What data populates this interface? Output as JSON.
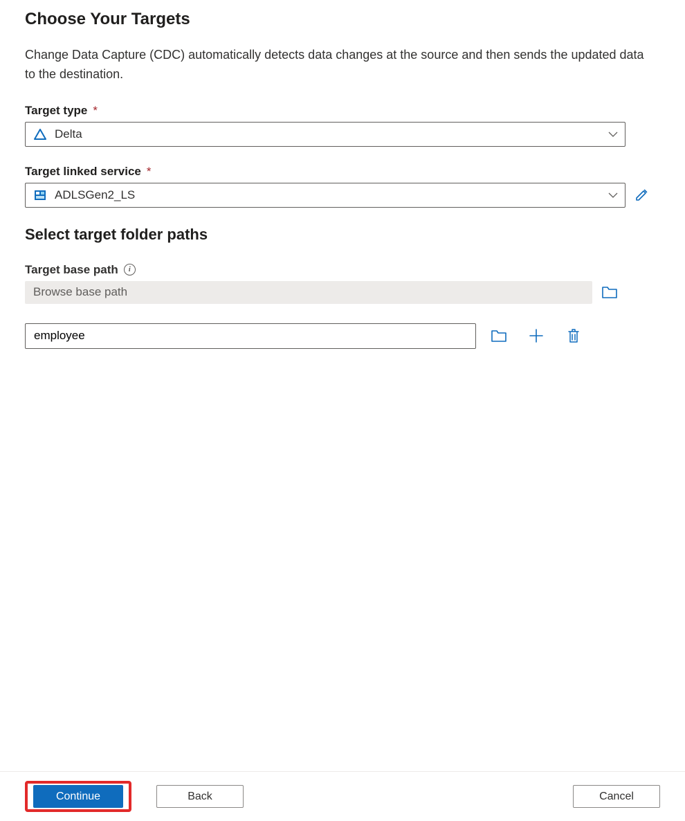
{
  "page": {
    "title": "Choose Your Targets",
    "description": "Change Data Capture (CDC) automatically detects data changes at the source and then sends the updated data to the destination."
  },
  "targetType": {
    "label": "Target type",
    "value": "Delta"
  },
  "linkedService": {
    "label": "Target linked service",
    "value": "ADLSGen2_LS"
  },
  "folderPaths": {
    "heading": "Select target folder paths",
    "basePathLabel": "Target base path",
    "basePathPlaceholder": "Browse base path",
    "pathValue": "employee"
  },
  "footer": {
    "continue": "Continue",
    "back": "Back",
    "cancel": "Cancel"
  },
  "colors": {
    "accent": "#0f6cbd",
    "required": "#a4262c",
    "highlight": "#e22a2a"
  }
}
